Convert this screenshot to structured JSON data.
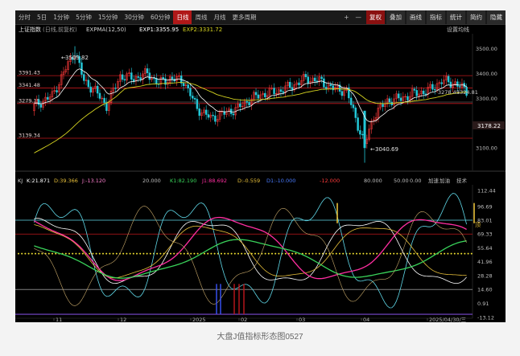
{
  "toolbar": {
    "periods": [
      "分时",
      "5日",
      "1分钟",
      "5分钟",
      "15分钟",
      "30分钟",
      "60分钟",
      "日线",
      "周线",
      "月线",
      "更多周期"
    ],
    "active_period": "日线",
    "right_controls": [
      "+",
      "—",
      "复权",
      "叠加",
      "画线",
      "指标",
      "统计",
      "简约",
      "隐藏"
    ],
    "controls_icons": [
      "plus-icon",
      "minus-icon"
    ]
  },
  "main_chart": {
    "legend_name": "上证指数",
    "legend_sub": "(日线,前复权)",
    "legend_expma": "EXPMA(12,50)",
    "legend_exp1": "EXP1:3355.95",
    "legend_exp2": "EXP2:3331.72",
    "settings_label": "设置均线",
    "price_axis": [
      "3500.00",
      "3400.00",
      "3300.00",
      "3200.00",
      "3100.00"
    ],
    "current_price": "3178.22",
    "hline_labels": [
      "3391.43",
      "3341.48",
      "3279.15",
      "3139.34"
    ],
    "annotation_high": "3509.82",
    "annotation_low": "3040.69",
    "annotation_right": "3324.81",
    "annotation_mid": "3278.45"
  },
  "kdj_panel": {
    "labels": [
      "KJ",
      "K:21.871",
      "D:39.366",
      "J:-13.120",
      "20.000",
      "K1:82.190",
      "J1:88.692",
      "D:-0.559",
      "D1:-10.000",
      "-12.000",
      "80.000",
      "50.00",
      "0.00",
      "加速",
      "加油",
      "技术"
    ],
    "axis": [
      "112.44",
      "96.69",
      "83.01",
      "69.33",
      "55.64",
      "41.96",
      "28.28",
      "14.60",
      "0.91",
      "-13.12"
    ],
    "right_marker": "顶"
  },
  "time_axis": [
    "11",
    "12",
    "2025",
    "02",
    "03",
    "04",
    "2025/04/30/三"
  ],
  "caption": "大盘J值指标形态图0527",
  "colors": {
    "up": "#ff3b3b",
    "down": "#23c8d8",
    "exp1": "#ffffff",
    "exp2": "#d6d420",
    "k": "#ffffff",
    "d": "#e8c03a",
    "j": "#ff2ea0",
    "green": "#39d35a",
    "cyan": "#5fd8e8",
    "hline": "#c0181d"
  },
  "chart_data": {
    "type": "candlestick",
    "title": "上证指数",
    "y_range": [
      3040.69,
      3509.82
    ],
    "annotated_levels": [
      3509.82,
      3391.43,
      3341.48,
      3279.15,
      3139.34,
      3040.69
    ],
    "last_close": 3178.22
  }
}
